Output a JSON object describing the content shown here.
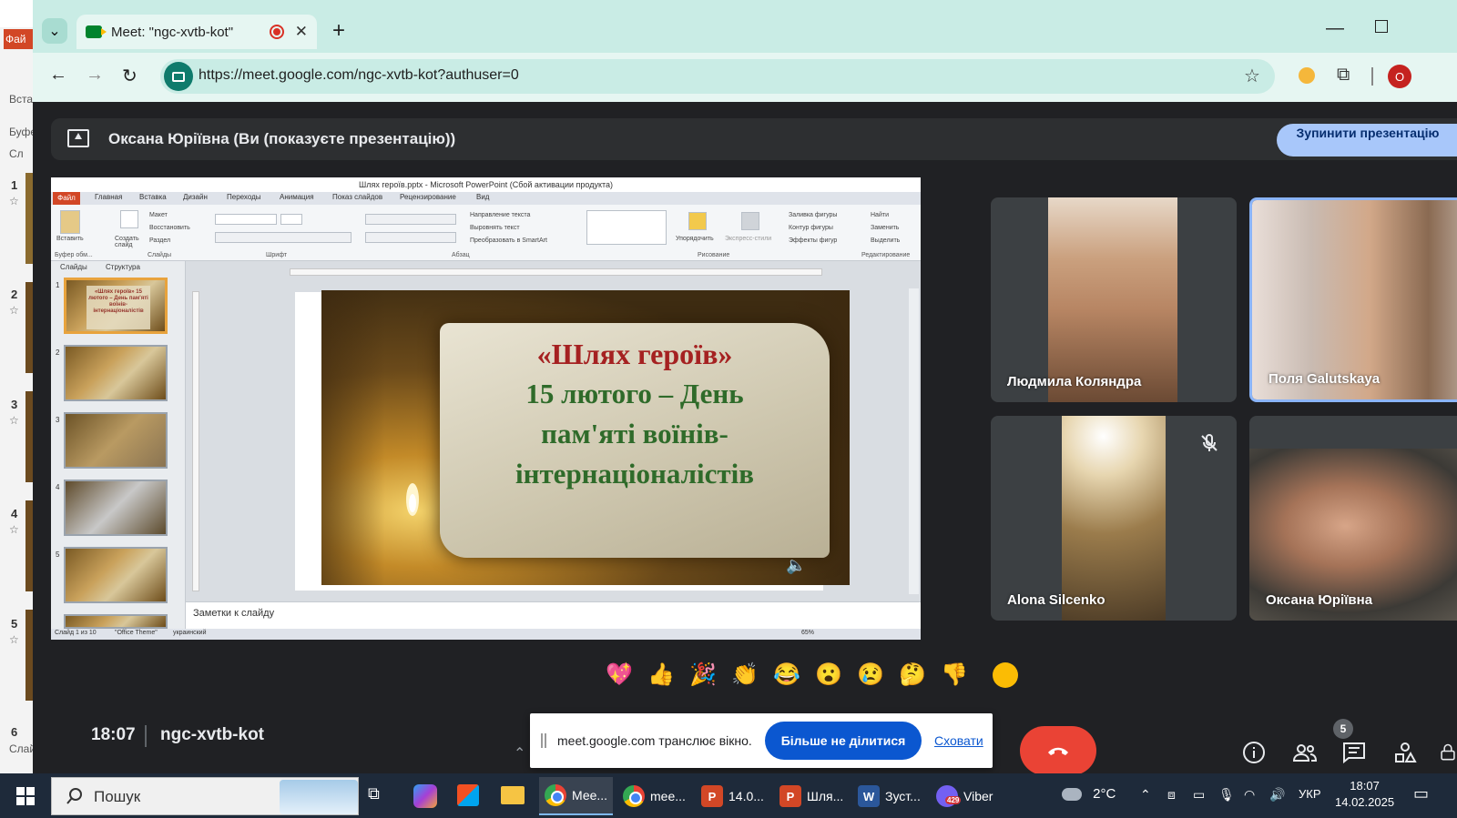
{
  "background_app": {
    "file_tab": "Фай",
    "insert_label": "Вста",
    "buffer_label": "Буфе",
    "slides_label": "Сл",
    "slide_numbers": [
      "1",
      "2",
      "3",
      "4",
      "5",
      "6"
    ],
    "bottom_label": "Слай"
  },
  "browser": {
    "tab_title": "Meet: \"ngc-xvtb-kot\"",
    "url": "https://meet.google.com/ngc-xvtb-kot?authuser=0",
    "profile_initial": "O"
  },
  "meet": {
    "presenting_text": "Оксана Юріївна (Ви (показуєте презентацію))",
    "stop_presenting_label": "Зупинити презентацію",
    "participants": [
      {
        "name": "Людмила Коляндра"
      },
      {
        "name": "Поля Galutskaya"
      },
      {
        "name": "Alona Silcenko"
      },
      {
        "name": "Оксана Юріївна"
      }
    ],
    "reactions": [
      "💖",
      "👍",
      "🎉",
      "👏",
      "😂",
      "😮",
      "😢",
      "🤔",
      "👎"
    ],
    "clock": "18:07",
    "meeting_code": "ngc-xvtb-kot",
    "share_banner": {
      "text": "meet.google.com транслює вікно.",
      "stop_sharing": "Більше не ділитися",
      "hide": "Сховати"
    },
    "people_count": "5"
  },
  "presentation": {
    "window_title": "Шлях героїв.pptx - Microsoft PowerPoint (Сбой активации продукта)",
    "tabs": [
      "Файл",
      "Главная",
      "Вставка",
      "Дизайн",
      "Переходы",
      "Анимация",
      "Показ слайдов",
      "Рецензирование",
      "Вид"
    ],
    "ribbon_groups": [
      "Буфер обм...",
      "Слайды",
      "Шрифт",
      "Абзац",
      "Рисование",
      "Редактирование"
    ],
    "ribbon_items": {
      "paste": "Вставить",
      "create_slide": "Создать слайд",
      "layout": "Макет",
      "restore": "Восстановить",
      "section": "Раздел",
      "text_direction": "Направление текста",
      "align_text": "Выровнять текст",
      "smartart": "Преобразовать в SmartArt",
      "arrange": "Упорядочить",
      "express_styles": "Экспресс-стили",
      "shape_fill": "Заливка фигуры",
      "shape_outline": "Контур фигуры",
      "shape_effects": "Эффекты фигур",
      "find": "Найти",
      "replace": "Заменить",
      "select": "Выделить"
    },
    "pane_tabs": [
      "Слайды",
      "Структура"
    ],
    "thumb_numbers": [
      "1",
      "2",
      "3",
      "4",
      "5"
    ],
    "thumb1_text": "«Шлях героїв» 15 лютого – День пам'яті воїнів-інтернаціоналістів",
    "slide_title": "«Шлях героїв»",
    "slide_lines": [
      "15 лютого – День",
      "пам'яті воїнів-",
      "інтернаціоналістів"
    ],
    "notes_placeholder": "Заметки к слайду",
    "status": {
      "slide": "Слайд 1 из 10",
      "theme": "\"Office Theme\"",
      "lang": "украинский",
      "zoom": "65%"
    }
  },
  "taskbar": {
    "search_placeholder": "Пошук",
    "apps": [
      {
        "label": "Мее...",
        "icon": "chrome-icon",
        "active": true
      },
      {
        "label": "mee...",
        "icon": "chrome-icon",
        "active": false
      },
      {
        "label": "14.0...",
        "icon": "powerpoint-icon",
        "active": false
      },
      {
        "label": "Шля...",
        "icon": "powerpoint-icon",
        "active": false
      },
      {
        "label": "Зуст...",
        "icon": "word-icon",
        "active": false
      },
      {
        "label": "Viber",
        "icon": "viber-icon",
        "active": false
      }
    ],
    "viber_badge": "429",
    "weather": "2°C",
    "language": "УКР",
    "time": "18:07",
    "date": "14.02.2025"
  },
  "colors": {
    "tab_strip": "#c9ece5",
    "meet_bg": "#202124",
    "primary_blue": "#0b57d0",
    "end_call_red": "#ea4335",
    "slide_title_red": "#a52121",
    "slide_text_green": "#2f6b2a"
  }
}
